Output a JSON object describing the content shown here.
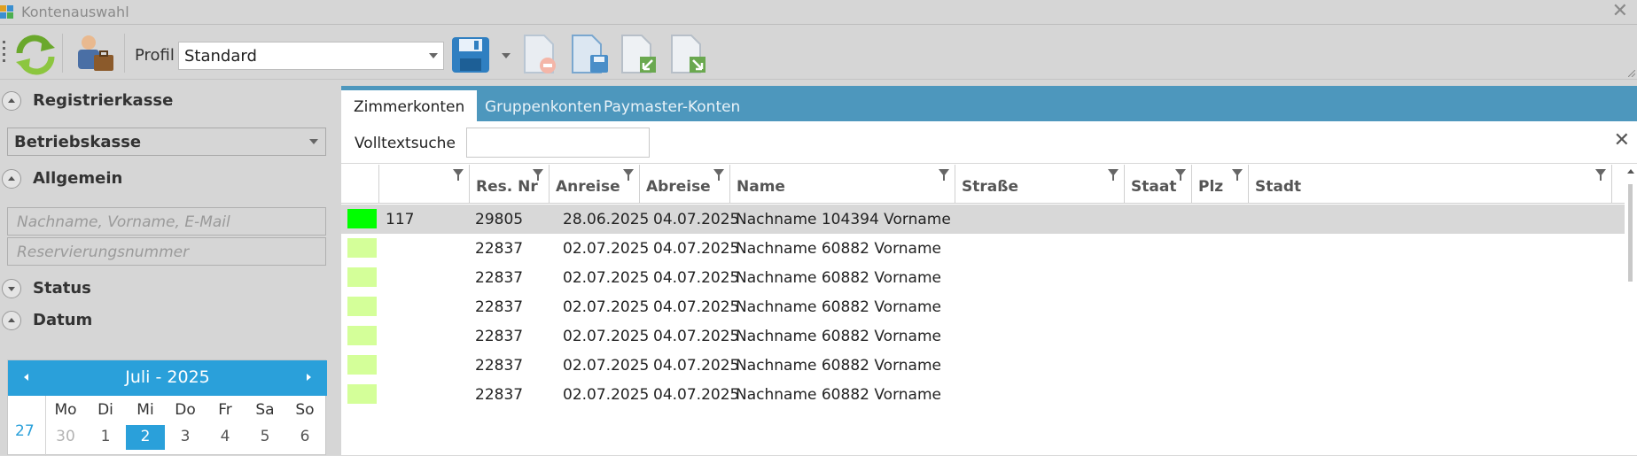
{
  "window": {
    "title": "Kontenauswahl"
  },
  "toolbar": {
    "profile_label": "Profil",
    "profile_value": "Standard"
  },
  "left": {
    "registrierkasse": {
      "label": "Registrierkasse",
      "value": "Betriebskasse"
    },
    "allgemein": {
      "label": "Allgemein",
      "name_placeholder": "Nachname, Vorname, E-Mail",
      "resnr_placeholder": "Reservierungsnummer"
    },
    "status_label": "Status",
    "datum_label": "Datum",
    "calendar": {
      "title": "Juli - 2025",
      "weekdays": [
        "Mo",
        "Di",
        "Mi",
        "Do",
        "Fr",
        "Sa",
        "So"
      ],
      "week_number": "27",
      "days": [
        "30",
        "1",
        "2",
        "3",
        "4",
        "5",
        "6"
      ],
      "selected_day": "2"
    }
  },
  "tabs": [
    "Zimmerkonten",
    "Gruppenkonten",
    "Paymaster-Konten"
  ],
  "search": {
    "label": "Volltextsuche",
    "value": ""
  },
  "grid": {
    "columns": [
      "",
      "",
      "Res. Nr",
      "Anreise",
      "Abreise",
      "Name",
      "Straße",
      "Staat",
      "Plz",
      "Stadt"
    ],
    "rows": [
      {
        "color": "#00ff00",
        "zimmer": "117",
        "resnr": "29805",
        "anreise": "28.06.2025",
        "abreise": "04.07.2025",
        "name": "Nachname 104394 Vorname",
        "selected": true
      },
      {
        "color": "#d4ff99",
        "zimmer": "",
        "resnr": "22837",
        "anreise": "02.07.2025",
        "abreise": "04.07.2025",
        "name": "Nachname 60882 Vorname",
        "selected": false
      },
      {
        "color": "#d4ff99",
        "zimmer": "",
        "resnr": "22837",
        "anreise": "02.07.2025",
        "abreise": "04.07.2025",
        "name": "Nachname 60882 Vorname",
        "selected": false
      },
      {
        "color": "#d4ff99",
        "zimmer": "",
        "resnr": "22837",
        "anreise": "02.07.2025",
        "abreise": "04.07.2025",
        "name": "Nachname 60882 Vorname",
        "selected": false
      },
      {
        "color": "#d4ff99",
        "zimmer": "",
        "resnr": "22837",
        "anreise": "02.07.2025",
        "abreise": "04.07.2025",
        "name": "Nachname 60882 Vorname",
        "selected": false
      },
      {
        "color": "#d4ff99",
        "zimmer": "",
        "resnr": "22837",
        "anreise": "02.07.2025",
        "abreise": "04.07.2025",
        "name": "Nachname 60882 Vorname",
        "selected": false
      },
      {
        "color": "#d4ff99",
        "zimmer": "",
        "resnr": "22837",
        "anreise": "02.07.2025",
        "abreise": "04.07.2025",
        "name": "Nachname 60882 Vorname",
        "selected": false
      }
    ]
  },
  "colors": {
    "accent": "#2aa0da",
    "tabbar": "#4d97bd"
  },
  "icons": {
    "refresh": "refresh-icon",
    "user_briefcase": "user-briefcase-icon",
    "save": "save-icon",
    "delete_doc": "delete-document-icon",
    "save_doc": "save-document-icon",
    "import_doc": "import-document-icon",
    "export_doc": "export-document-icon"
  }
}
